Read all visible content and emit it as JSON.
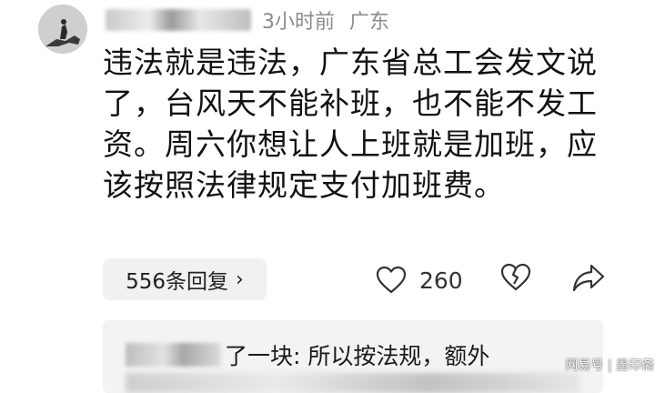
{
  "comment": {
    "time": "3小时前",
    "location": "广东",
    "text": "违法就是违法，广东省总工会发文说了，台风天不能补班，也不能不发工资。周六你想让人上班就是加班，应该按照法律规定支付加班费。",
    "reply_count_label": "556条回复",
    "reply_chevron": "›",
    "like_count": "260"
  },
  "sub_reply": {
    "text": "了一块: 所以按法规，额外"
  },
  "watermark": "网易号 | 墨印斋",
  "icons": {
    "avatar": "avatar-horse-rider",
    "like": "heart-outline-icon",
    "dislike": "broken-heart-icon",
    "share": "share-arrow-icon",
    "chevron": "chevron-right-icon"
  }
}
